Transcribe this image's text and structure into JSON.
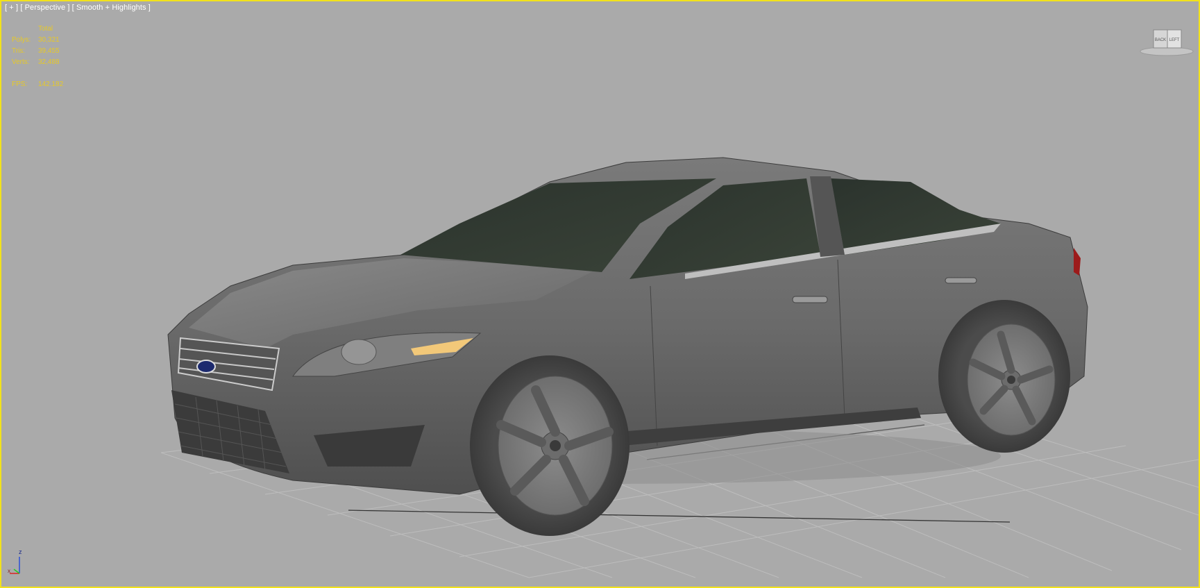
{
  "viewport": {
    "label_plus": "[ + ]",
    "label_view": "[ Perspective ]",
    "label_shading": "[ Smooth + Highlights ]",
    "border_color": "#f2e21a",
    "background": "#aaaaaa"
  },
  "statistics": {
    "header": "Total",
    "rows": [
      {
        "label": "Polys:",
        "value": "30,321"
      },
      {
        "label": "Tris:",
        "value": "39,455"
      },
      {
        "label": "Verts:",
        "value": "32,488"
      }
    ],
    "fps_label": "FPS:",
    "fps_value": "142.182",
    "color": "#e7c927"
  },
  "viewcube": {
    "left_face": "BACK",
    "right_face": "LEFT"
  },
  "axis_tripod": {
    "z": "z",
    "x": "x"
  },
  "icons": {
    "viewcube": "viewcube-icon",
    "axis": "axis-tripod-icon"
  }
}
